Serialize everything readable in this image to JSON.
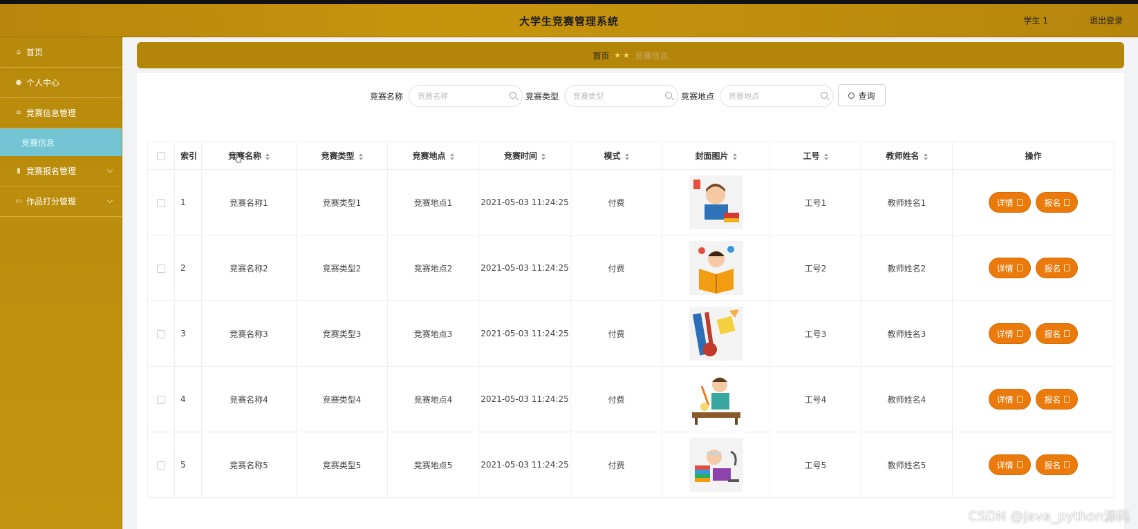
{
  "header": {
    "title": "大学生竞赛管理系统",
    "user": "学生 1",
    "logout": "退出登录"
  },
  "sidebar": {
    "items": [
      {
        "label": "首页",
        "icon": "home-icon"
      },
      {
        "label": "个人中心",
        "icon": "user-icon"
      },
      {
        "label": "竞赛信息管理",
        "icon": "list-icon"
      },
      {
        "label": "竞赛信息",
        "icon": ""
      },
      {
        "label": "竞赛报名管理",
        "icon": "lock-icon"
      },
      {
        "label": "作品打分管理",
        "icon": "message-icon"
      }
    ]
  },
  "breadcrumb": {
    "home": "首页",
    "current": "竞赛信息"
  },
  "search": {
    "name_label": "竞赛名称",
    "name_placeholder": "竞赛名称",
    "type_label": "竞赛类型",
    "type_placeholder": "竞赛类型",
    "location_label": "竞赛地点",
    "location_placeholder": "竞赛地点",
    "query_label": "查询"
  },
  "table": {
    "headers": [
      "索引",
      "竞赛名称",
      "竞赛类型",
      "竞赛地点",
      "竞赛时间",
      "模式",
      "封面图片",
      "工号",
      "教师姓名",
      "操作"
    ],
    "rows": [
      {
        "index": "1",
        "name": "竞赛名称1",
        "type": "竞赛类型1",
        "location": "竞赛地点1",
        "time": "2021-05-03 11:24:25",
        "mode": "付费",
        "job_no": "工号1",
        "teacher": "教师姓名1"
      },
      {
        "index": "2",
        "name": "竞赛名称2",
        "type": "竞赛类型2",
        "location": "竞赛地点2",
        "time": "2021-05-03 11:24:25",
        "mode": "付费",
        "job_no": "工号2",
        "teacher": "教师姓名2"
      },
      {
        "index": "3",
        "name": "竞赛名称3",
        "type": "竞赛类型3",
        "location": "竞赛地点3",
        "time": "2021-05-03 11:24:25",
        "mode": "付费",
        "job_no": "工号3",
        "teacher": "教师姓名3"
      },
      {
        "index": "4",
        "name": "竞赛名称4",
        "type": "竞赛类型4",
        "location": "竞赛地点4",
        "time": "2021-05-03 11:24:25",
        "mode": "付费",
        "job_no": "工号4",
        "teacher": "教师姓名4"
      },
      {
        "index": "5",
        "name": "竞赛名称5",
        "type": "竞赛类型5",
        "location": "竞赛地点5",
        "time": "2021-05-03 11:24:25",
        "mode": "付费",
        "job_no": "工号5",
        "teacher": "教师姓名5"
      }
    ],
    "detail_label": "详情",
    "signup_label": "报名"
  },
  "watermark": "CSDN @java_python源码",
  "colors": {
    "header": "#b8860b",
    "accent": "#e97a0b",
    "sub_menu_active": "#73c5d4"
  }
}
